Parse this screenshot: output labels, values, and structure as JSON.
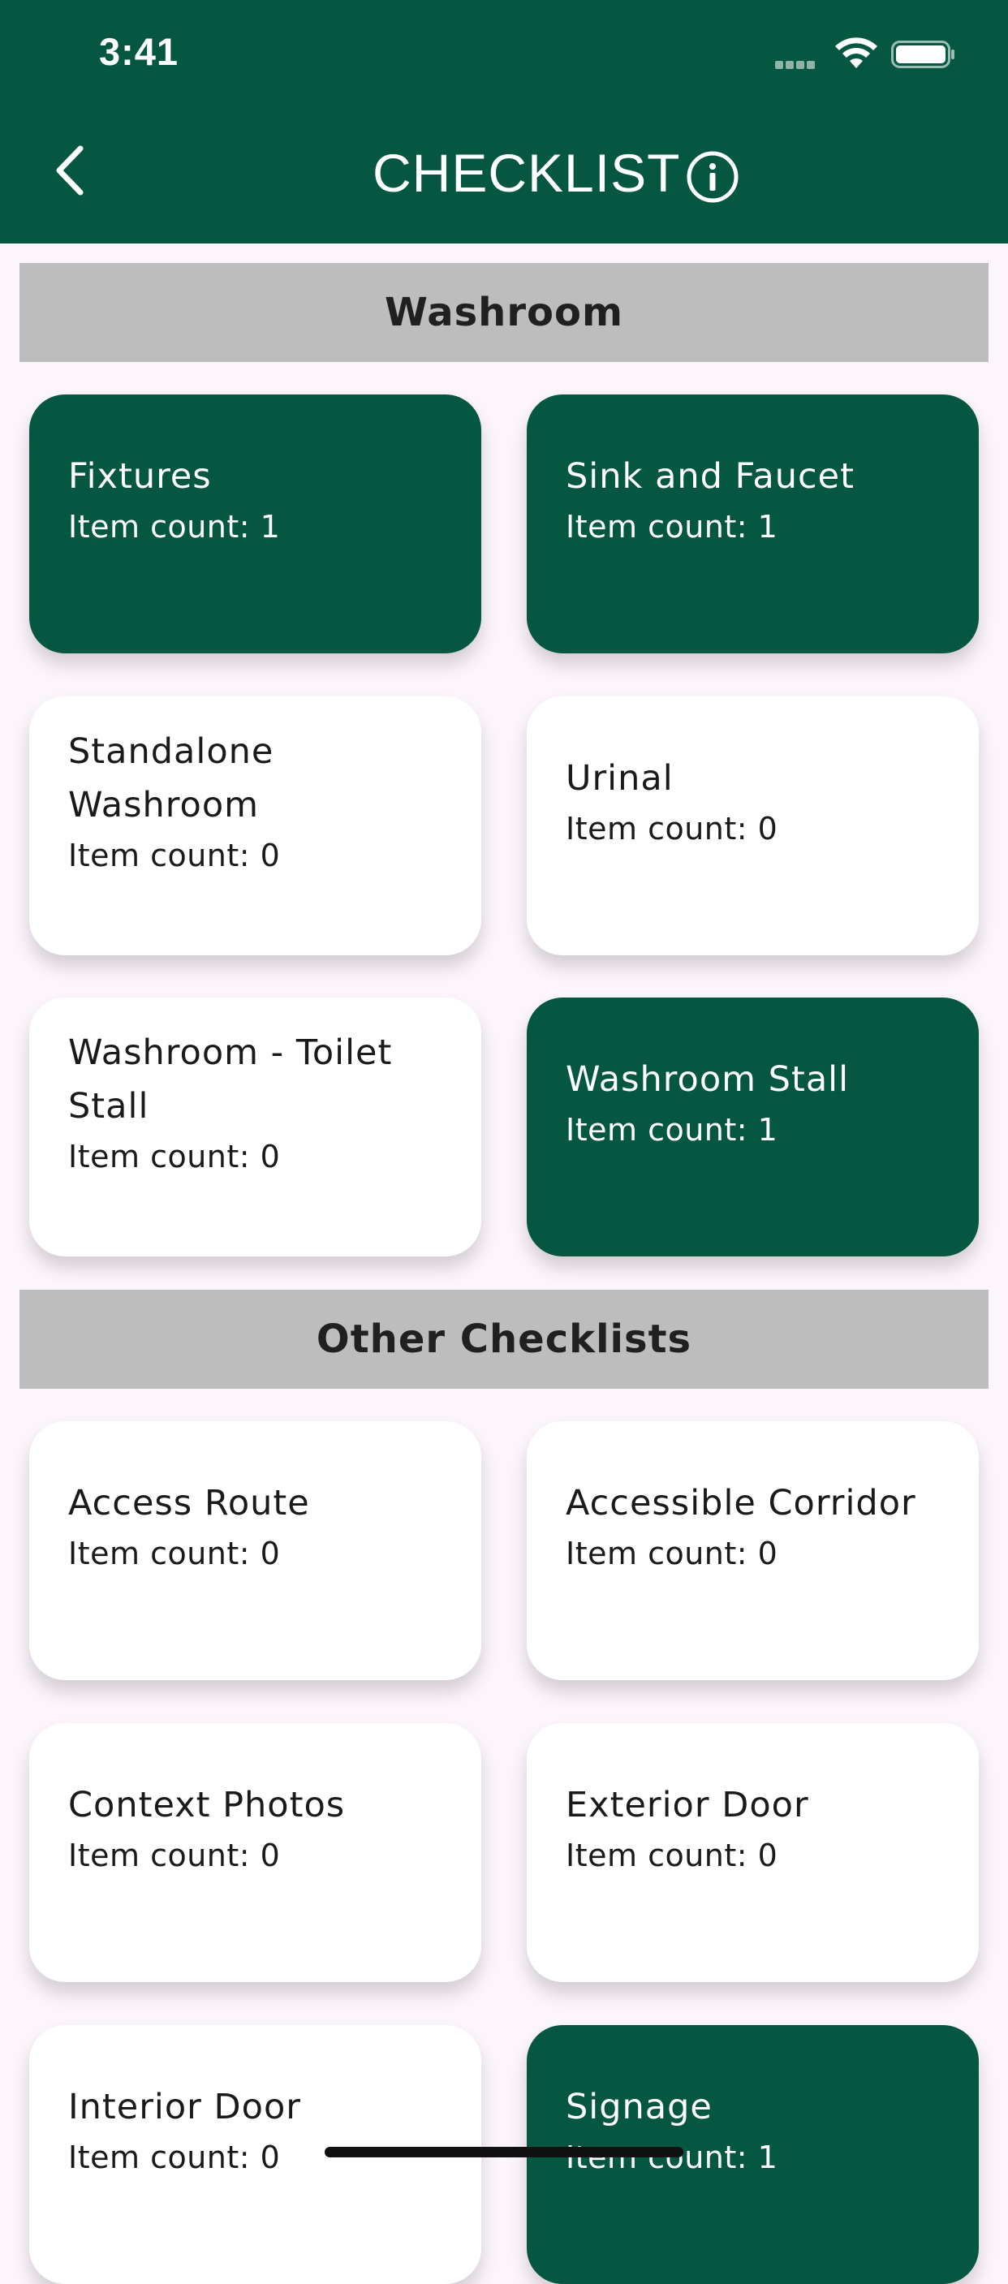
{
  "status_bar": {
    "time": "3:41"
  },
  "nav": {
    "title": "CHECKLIST"
  },
  "sections": [
    {
      "title": "Washroom",
      "cards": [
        {
          "title": "Fixtures",
          "count": "Item count: 1",
          "active": true
        },
        {
          "title": "Sink and Faucet",
          "count": "Item count: 1",
          "active": true
        },
        {
          "title": "Standalone Washroom",
          "count": "Item count: 0",
          "active": false
        },
        {
          "title": "Urinal",
          "count": "Item count: 0",
          "active": false
        },
        {
          "title": "Washroom - Toilet Stall",
          "count": "Item count: 0",
          "active": false
        },
        {
          "title": "Washroom Stall",
          "count": "Item count: 1",
          "active": true
        }
      ]
    },
    {
      "title": "Other Checklists",
      "cards": [
        {
          "title": "Access Route",
          "count": "Item count: 0",
          "active": false
        },
        {
          "title": "Accessible Corridor",
          "count": "Item count: 0",
          "active": false
        },
        {
          "title": "Context Photos",
          "count": "Item count: 0",
          "active": false
        },
        {
          "title": "Exterior Door",
          "count": "Item count: 0",
          "active": false
        },
        {
          "title": "Interior Door",
          "count": "Item count: 0",
          "active": false
        },
        {
          "title": "Signage",
          "count": "Item count: 1",
          "active": true
        }
      ]
    }
  ],
  "colors": {
    "primary": "#055741",
    "background": "#fcf5fc",
    "section_header": "#bdbdbd",
    "card_inactive": "#ffffff"
  },
  "icons": {
    "back": "chevron-left-icon",
    "info": "info-circle-icon"
  }
}
